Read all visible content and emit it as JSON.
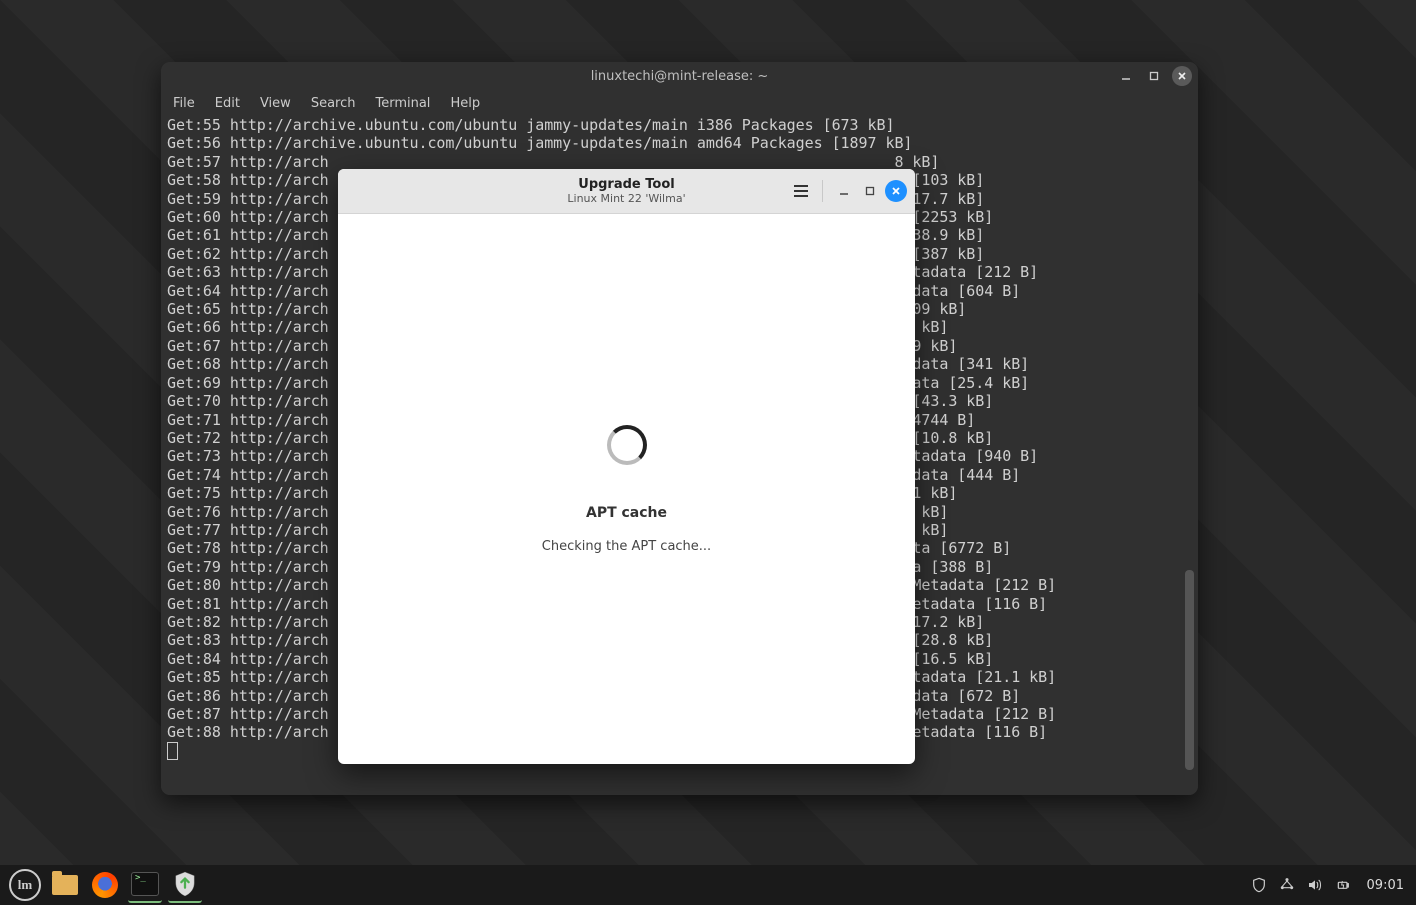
{
  "terminal": {
    "title": "linuxtechi@mint-release: ~",
    "menu": [
      "File",
      "Edit",
      "View",
      "Search",
      "Terminal",
      "Help"
    ],
    "lines": [
      "Get:55 http://archive.ubuntu.com/ubuntu jammy-updates/main i386 Packages [673 kB]",
      "Get:56 http://archive.ubuntu.com/ubuntu jammy-updates/main amd64 Packages [1897 kB]",
      "Get:57 http://arch                                                               8 kB]",
      "Get:58 http://arch                                                              ta [103 kB]",
      "Get:59 http://arch                                                              a [17.7 kB]",
      "Get:60 http://arch                                                              es [2253 kB]",
      "Get:61 http://arch                                                              s [38.9 kB]",
      "Get:62 http://arch                                                              en [387 kB]",
      "Get:63 http://arch                                                               Metadata [212 B]",
      "Get:64 http://arch                                                              etadata [604 B]",
      "Get:65 http://arch                                                              [1109 kB]",
      "Get:66 http://arch                                                              724 kB]",
      "Get:67 http://arch                                                              [259 kB]",
      "Get:68 http://arch                                                              etadata [341 kB]",
      "Get:69 http://arch                                                              tadata [25.4 kB]",
      "Get:70 http://arch                                                              es [43.3 kB]",
      "Get:71 http://arch                                                              s [4744 B]",
      "Get:72 http://arch                                                              en [10.8 kB]",
      "Get:73 http://arch                                                               Metadata [940 B]",
      "Get:74 http://arch                                                              etadata [444 B]",
      "Get:75 http://arch                                                              57.1 kB]",
      "Get:76 http://arch                                                              0.3 kB]",
      "Get:77 http://arch                                                              1.0 kB]",
      "Get:78 http://arch                                                              adata [6772 B]",
      "Get:79 http://arch                                                              data [388 B]",
      "Get:80 http://arch                                                              11 Metadata [212 B]",
      "Get:81 http://arch                                                              f Metadata [116 B]",
      "Get:82 http://arch                                                              s [17.2 kB]",
      "Get:83 http://arch                                                              es [28.8 kB]",
      "Get:84 http://arch                                                              en [16.5 kB]",
      "Get:85 http://arch                                                               Metadata [21.1 kB]",
      "Get:86 http://arch                                                              etadata [672 B]",
      "Get:87 http://arch                                                              11 Metadata [212 B]",
      "Get:88 http://arch                                                              f Metadata [116 B]"
    ]
  },
  "dialog": {
    "title": "Upgrade Tool",
    "subtitle": "Linux Mint 22 'Wilma'",
    "heading": "APT cache",
    "message": "Checking the APT cache..."
  },
  "taskbar": {
    "clock": "09:01"
  }
}
